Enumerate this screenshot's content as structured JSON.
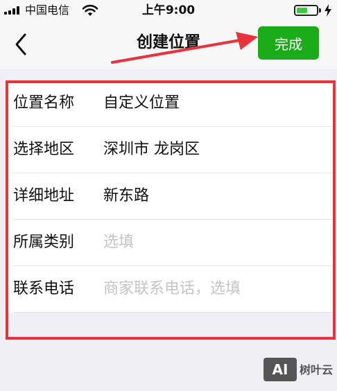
{
  "status_bar": {
    "carrier": "中国电信",
    "time": "上午9:00",
    "battery_level": 0.55
  },
  "nav": {
    "title": "创建位置",
    "done_label": "完成"
  },
  "form": {
    "rows": [
      {
        "label": "位置名称",
        "value": "自定义位置",
        "placeholder": ""
      },
      {
        "label": "选择地区",
        "value": "深圳市 龙岗区",
        "placeholder": ""
      },
      {
        "label": "详细地址",
        "value": "新东路",
        "placeholder": ""
      },
      {
        "label": "所属类别",
        "value": "",
        "placeholder": "选填"
      },
      {
        "label": "联系电话",
        "value": "",
        "placeholder": "商家联系电话，选填"
      }
    ]
  },
  "watermark": {
    "badge": "AI",
    "text": "树叶云"
  },
  "colors": {
    "accent_green": "#1aad19",
    "highlight_red": "#e8323c",
    "placeholder_gray": "#c4c4c4"
  }
}
